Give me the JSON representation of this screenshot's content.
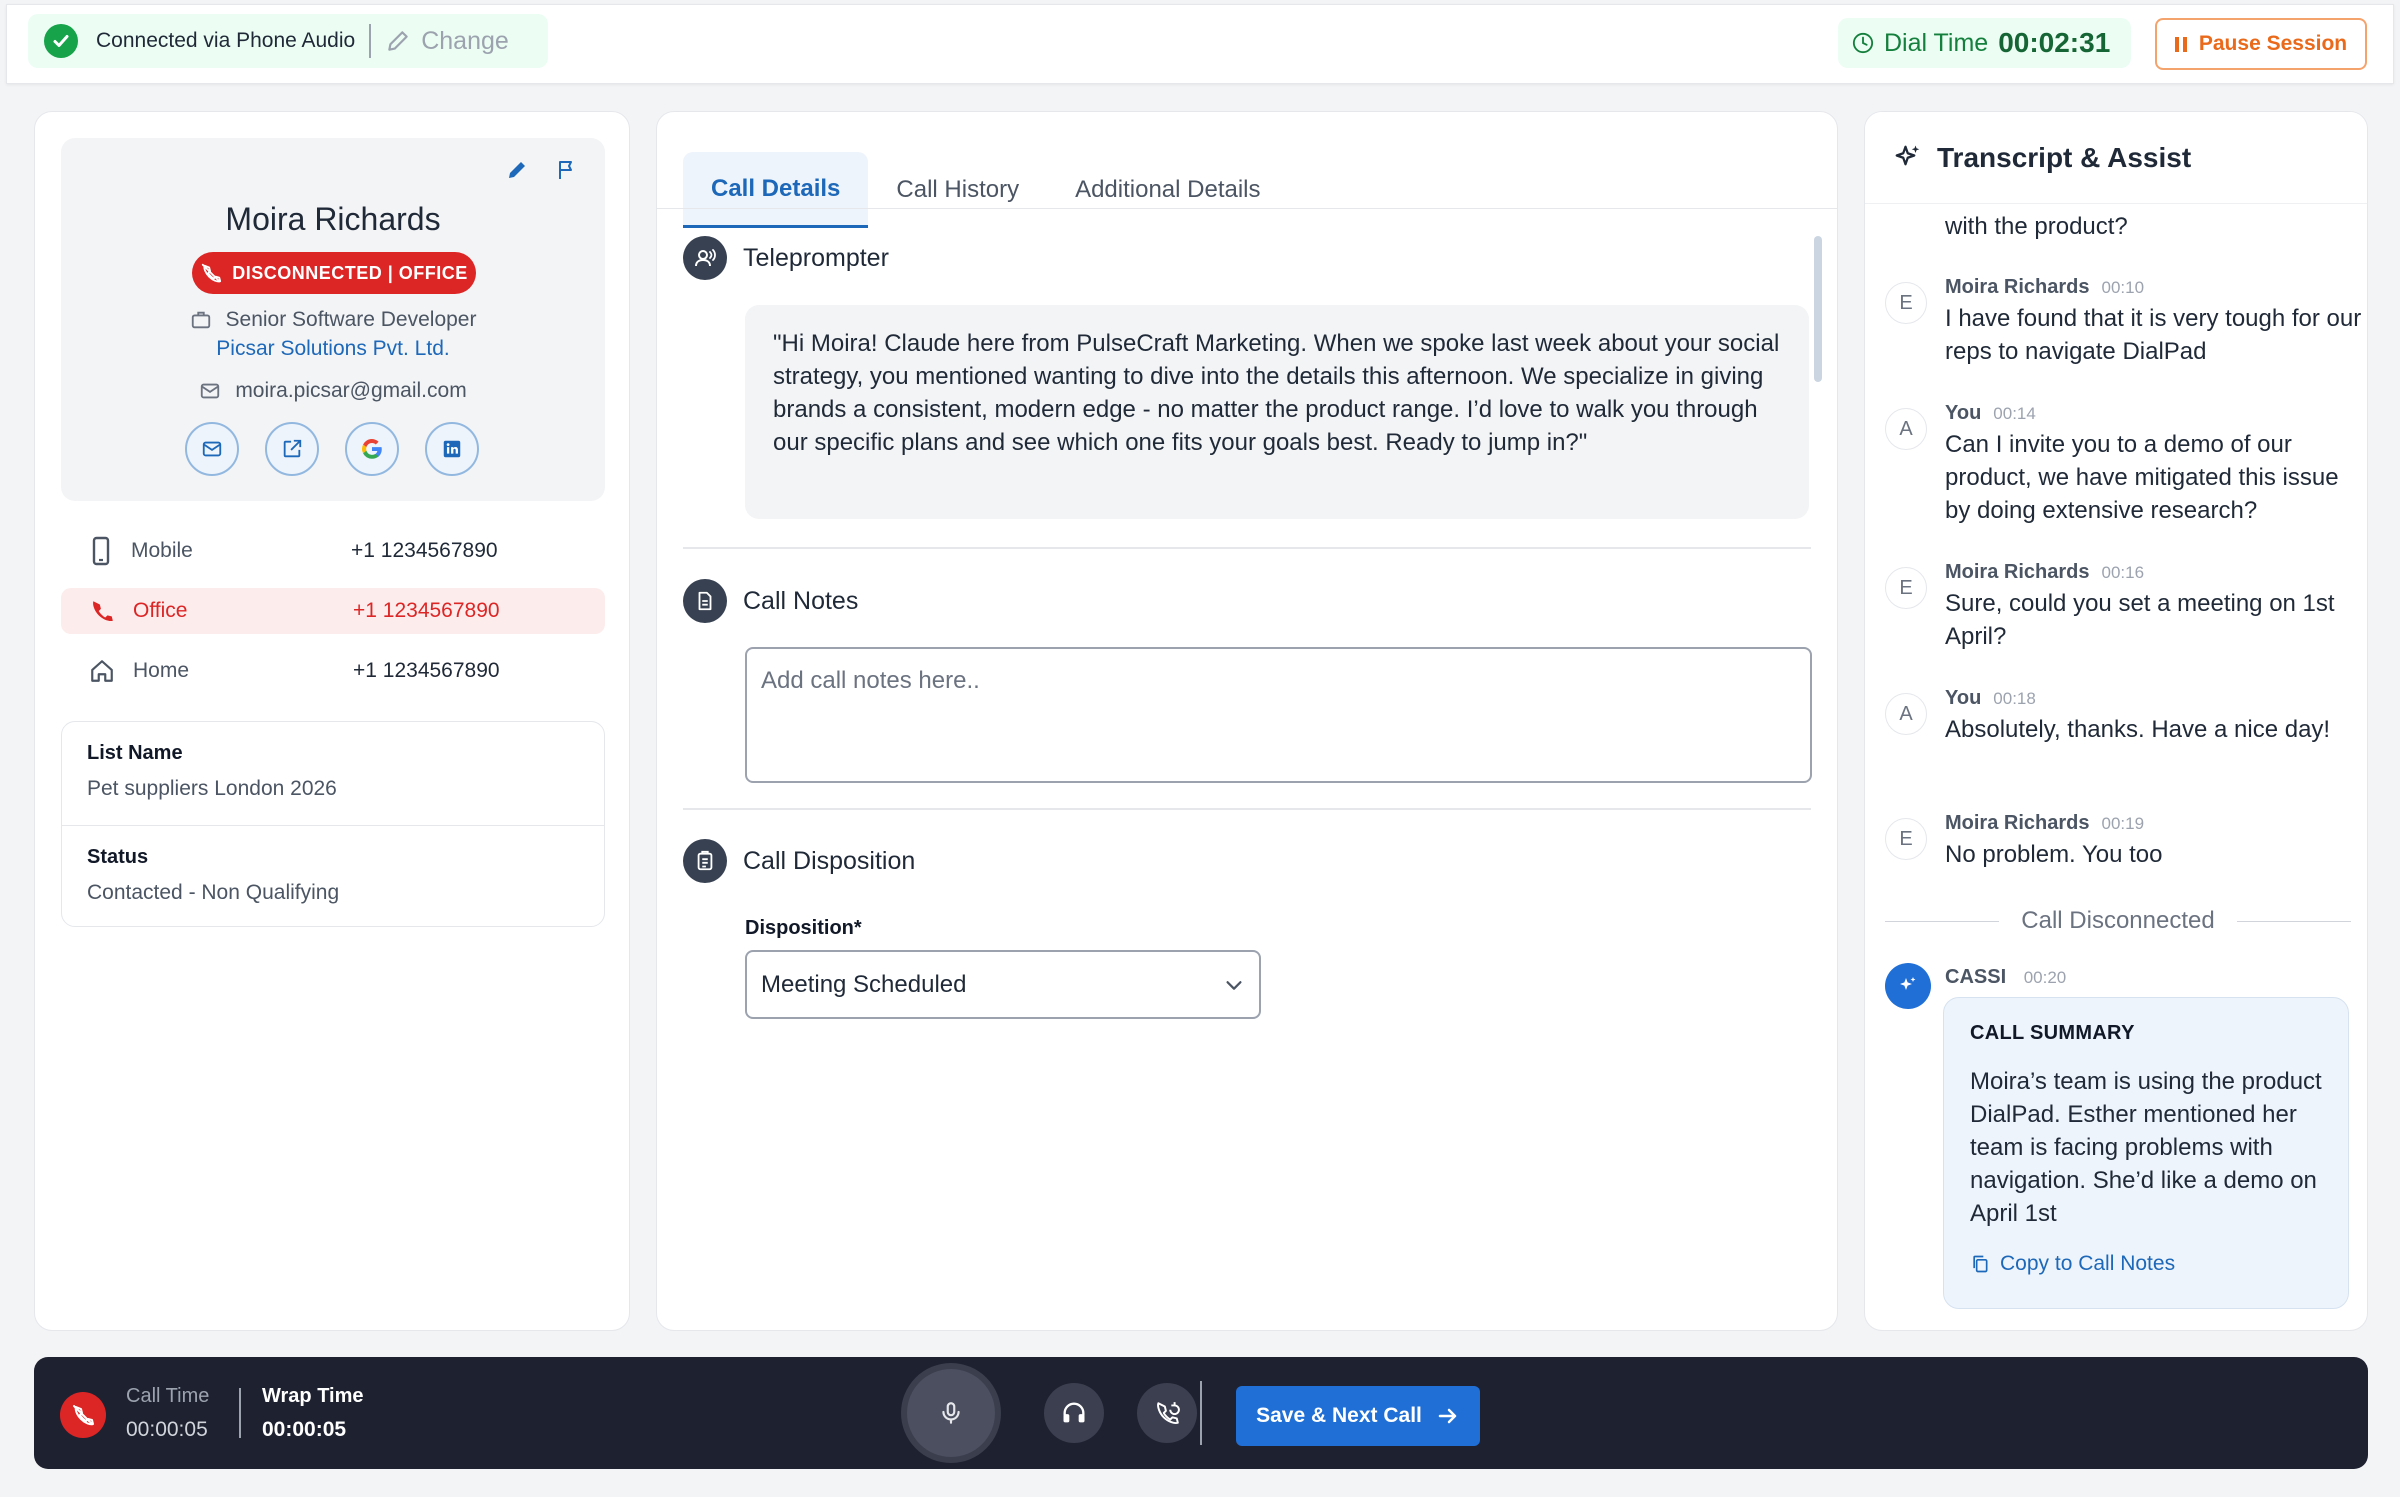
{
  "topbar": {
    "connection_status": "Connected via Phone Audio",
    "change_label": "Change",
    "dial_time_label": "Dial Time",
    "dial_time_value": "00:02:31",
    "pause_label": "Pause Session"
  },
  "contact": {
    "name": "Moira Richards",
    "status_badge": "DISCONNECTED | OFFICE",
    "title": "Senior Software Developer",
    "company": "Picsar Solutions Pvt. Ltd.",
    "email": "moira.picsar@gmail.com",
    "social_icons": [
      "mail-icon",
      "external-link-icon",
      "google-icon",
      "linkedin-icon"
    ],
    "phones": [
      {
        "label": "Mobile",
        "number": "+1 1234567890",
        "icon": "smartphone-icon",
        "active": false
      },
      {
        "label": "Office",
        "number": "+1 1234567890",
        "icon": "phone-icon",
        "active": true
      },
      {
        "label": "Home",
        "number": "+1 1234567890",
        "icon": "home-icon",
        "active": false
      }
    ],
    "list_name_label": "List Name",
    "list_name_value": "Pet suppliers London 2026",
    "status_label": "Status",
    "status_value": "Contacted - Non Qualifying"
  },
  "tabs": [
    "Call Details",
    "Call History",
    "Additional Details"
  ],
  "active_tab": "Call Details",
  "teleprompter": {
    "title": "Teleprompter",
    "text": "\"Hi Moira! Claude here from PulseCraft Marketing. When we spoke last week about your social strategy, you mentioned wanting to dive into the details this afternoon. We specialize in giving brands a consistent, modern edge - no matter the product range. I’d love to walk you through our specific plans and see which one fits your goals best. Ready to jump in?\""
  },
  "call_notes": {
    "title": "Call Notes",
    "placeholder": "Add call notes here.."
  },
  "disposition": {
    "title": "Call Disposition",
    "label": "Disposition*",
    "selected": "Meeting Scheduled"
  },
  "transcript": {
    "title": "Transcript & Assist",
    "partial_text": "with the product?",
    "messages": [
      {
        "avatar": "E",
        "speaker": "Moira Richards",
        "time": "00:10",
        "text": "I have found that it is very tough for our reps to navigate DialPad"
      },
      {
        "avatar": "A",
        "speaker": "You",
        "time": "00:14",
        "text": "Can I invite you to a demo of our product, we have mitigated this issue by doing extensive research?"
      },
      {
        "avatar": "E",
        "speaker": "Moira Richards",
        "time": "00:16",
        "text": "Sure, could you set a meeting on 1st April?"
      },
      {
        "avatar": "A",
        "speaker": "You",
        "time": "00:18",
        "text": "Absolutely, thanks. Have a nice day!"
      },
      {
        "avatar": "E",
        "speaker": "Moira Richards",
        "time": "00:19",
        "text": "No problem. You too"
      }
    ],
    "disconnected_label": "Call Disconnected",
    "assistant_name": "CASSI",
    "assistant_time": "00:20",
    "summary_heading": "CALL SUMMARY",
    "summary_text": "Moira’s team is using the product DialPad. Esther mentioned her team is facing problems with navigation. She’d like a demo on April 1st",
    "copy_label": "Copy to Call Notes"
  },
  "bottom": {
    "call_time_label": "Call Time",
    "call_time_value": "00:00:05",
    "wrap_time_label": "Wrap Time",
    "wrap_time_value": "00:00:05",
    "save_label": "Save & Next Call"
  },
  "colors": {
    "accent": "#1d68b8",
    "danger": "#dc2626",
    "success": "#16a34a",
    "warning": "#ea6a1b",
    "bottom_bar": "#1e2130"
  }
}
